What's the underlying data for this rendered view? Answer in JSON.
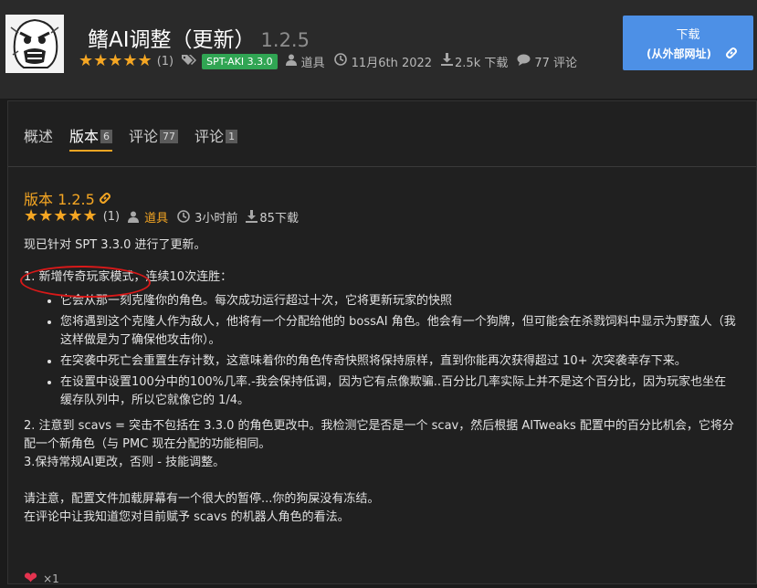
{
  "header": {
    "title": "鳍AI调整（更新）",
    "version": "1.2.5",
    "rating_count": "(1)",
    "tag": "SPT-AKI 3.3.0",
    "author": "道具",
    "date": "11月6th 2022",
    "downloads": "2.5k 下载",
    "comments": "77 评论"
  },
  "download_button": {
    "line1": "下载",
    "line2": "(从外部网址)"
  },
  "tabs": [
    {
      "label": "概述",
      "count": ""
    },
    {
      "label": "版本",
      "count": "6"
    },
    {
      "label": "评论",
      "count": "77"
    },
    {
      "label": "评论",
      "count": "1"
    }
  ],
  "version_entry": {
    "heading": "版本 1.2.5",
    "rating_count": "(1)",
    "author": "道具",
    "time": "3小时前",
    "downloads": "85下载"
  },
  "content": {
    "intro": "现已针对 SPT 3.3.0 进行了更新。",
    "point1": "1. 新增传奇玩家模式，连续10次连胜：",
    "bullets": [
      "它会从那一刻克隆你的角色。每次成功运行超过十次，它将更新玩家的快照",
      "您将遇到这个克隆人作为敌人，他将有一个分配给他的 bossAI 角色。他会有一个狗牌，但可能会在杀戮饲料中显示为野蛮人（我这样做是为了确保他攻击你）。",
      "在突袭中死亡会重置生存计数，这意味着你的角色传奇快照将保持原样，直到你能再次获得超过 10+ 次突袭幸存下来。",
      "在设置中设置100分中的100%几率.-我会保持低调，因为它有点像欺骗..百分比几率实际上并不是这个百分比，因为玩家也坐在缓存队列中，所以它就像它的 1/4。"
    ],
    "point2": "2. 注意到 scavs = 突击不包括在 3.3.0 的角色更改中。我检测它是否是一个 scav，然后根据 AITweaks 配置中的百分比机会，它将分配一个新角色（与 PMC 现在分配的功能相同。",
    "point3": "3.保持常规AI更改，否则 - 技能调整。",
    "note1": "请注意，配置文件加载屏幕有一个很大的暂停...你的狗屎没有冻结。",
    "note2": "在评论中让我知道您对目前赋予 scavs 的机器人角色的看法。"
  },
  "likes": "×1",
  "colors": {
    "accent": "#f5a623",
    "tag_green": "#30a553",
    "button_blue": "#4d90e6",
    "circle_red": "#d81919"
  }
}
